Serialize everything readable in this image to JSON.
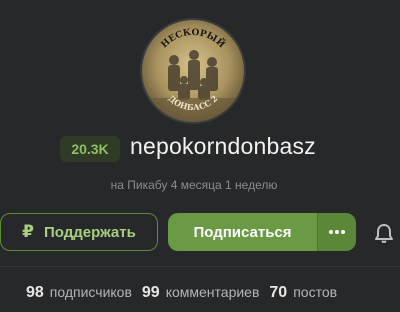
{
  "profile": {
    "avatar_caption_top": "НЕСКОРЫЙ",
    "avatar_caption_bottom": "ДОНБАСС 2",
    "rating": "20.3K",
    "username": "nepokorndonbasz",
    "meta": "на Пикабу 4 месяца 1 неделю"
  },
  "actions": {
    "support_icon": "ruble-icon",
    "support_label": "Поддержать",
    "subscribe_label": "Подписаться",
    "more_icon": "more-dots-icon",
    "bell_icon": "bell-icon"
  },
  "stats": {
    "subscribers_count": "98",
    "subscribers_label": "подписчиков",
    "comments_count": "99",
    "comments_label": "комментариев",
    "posts_count": "70",
    "posts_label": "постов"
  },
  "colors": {
    "background": "#272829",
    "accent": "#6a9a44",
    "rating_text": "#8fbf63"
  }
}
